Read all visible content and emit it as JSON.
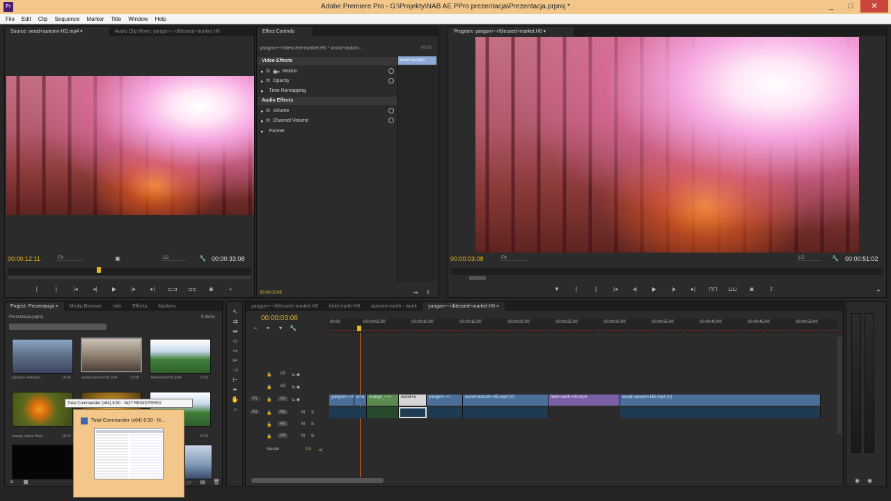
{
  "window": {
    "title": "Adobe Premiere Pro - G:\\Projekty\\NAB AE PPro prezentacja\\Prezentacja.prproj *",
    "app_icon": "Pr",
    "controls": [
      "_",
      "□",
      "✕"
    ]
  },
  "menu": [
    "File",
    "Edit",
    "Clip",
    "Sequence",
    "Marker",
    "Title",
    "Window",
    "Help"
  ],
  "source_monitor": {
    "tabs": [
      "Source: wood+autumn-HD.mp4 ▾",
      "Audio Clip Mixer: yangon+-+/blessed+market.H0"
    ],
    "timecode_in": "00:00:12:11",
    "fit": "Fit",
    "resolution": "1/2",
    "timecode_duration": "00:00:33:08"
  },
  "effect_controls": {
    "tab": "Effect Controls",
    "clip_name": "yangon+-+/blessed+market.H0 * wood+autum...",
    "clip_time": "00:00",
    "clip_label": "wood+autumi",
    "video_effects_label": "Video Effects",
    "video_effects": [
      "Motion",
      "Opacity",
      "Time Remapping"
    ],
    "audio_effects_label": "Audio Effects",
    "audio_effects": [
      "Volume",
      "Channel Volume",
      "Panner"
    ],
    "fx_prefix": "fx",
    "footer_time": "00:00:03:08"
  },
  "program_monitor": {
    "tab": "Program: yangon+-+/blessed+market.H0 ▾",
    "timecode_in": "00:00:03:08",
    "fit": "Fit",
    "resolution": "1/2",
    "timecode_duration": "00:00:51:02"
  },
  "project_panel": {
    "tabs": [
      "Project: Prezentacja ×",
      "Media Browser",
      "Info",
      "Effects",
      "Markers"
    ],
    "path": "Prezentacja.prproj",
    "items_count": "9 Items",
    "items": [
      {
        "label": "yangon+-+/blesse...",
        "duration": "14:03"
      },
      {
        "label": "wood+autumn-HD.mp4",
        "duration": "33:08"
      },
      {
        "label": "field+earth-HD.mp4",
        "duration": "10:01"
      },
      {
        "label": "orange_tulsen+fruit...",
        "duration": "16:19"
      },
      {
        "label": "",
        "duration": ""
      },
      {
        "label": "",
        "duration": "10:01"
      }
    ]
  },
  "taskbar_popup": {
    "tooltip": "Total Commander (x64) 8.50 - NOT REGISTERED",
    "window_title": "Total Commander (x64) 8.50 - N..."
  },
  "timeline": {
    "tabs": [
      "yangon+-+/blessed+market.H0",
      "field+earth-H0",
      "autumn+earth - week",
      "yangon+-+/blessed+market.H0 ×"
    ],
    "playhead_time": "00:00:03:08",
    "ruler_marks": [
      "00:00",
      "00:00:05:00",
      "00:00:10:00",
      "00:00:15:00",
      "00:00:20:00",
      "00:00:25:00",
      "00:00:30:00",
      "00:00:35:00",
      "00:00:40:00",
      "00:00:45:00",
      "00:00:50:00"
    ],
    "video_tracks": [
      "V3",
      "V2",
      "V1"
    ],
    "audio_tracks": [
      "A1",
      "A2",
      "A3"
    ],
    "source_v": "V1",
    "source_a": "A1",
    "master_label": "Master",
    "master_value": "0.0",
    "track_buttons": [
      "M",
      "S"
    ],
    "clips": [
      {
        "label": "yangon+-+/b",
        "color": "#4a6f99"
      },
      {
        "label": "w+a",
        "color": "#4a6f99"
      },
      {
        "label": "orange_+ (+",
        "color": "#5a8b4c"
      },
      {
        "label": "wood+a",
        "color": "#d7d7d7"
      },
      {
        "label": "yangon+-+/",
        "color": "#4a6f99"
      },
      {
        "label": "wood+autumn-HD.mp4 [V]",
        "color": "#4a6f99"
      },
      {
        "label": "field+earth-HD.mp4",
        "color": "#7b5fa6"
      },
      {
        "label": "wood+autumn-HD.mp4 [V]",
        "color": "#4a6f99"
      }
    ]
  },
  "colors": {
    "accent_timecode": "#e2b624",
    "panel_bg": "#2b2b2b",
    "title_bg": "#f3c78a",
    "playhead": "#e36a2a"
  }
}
